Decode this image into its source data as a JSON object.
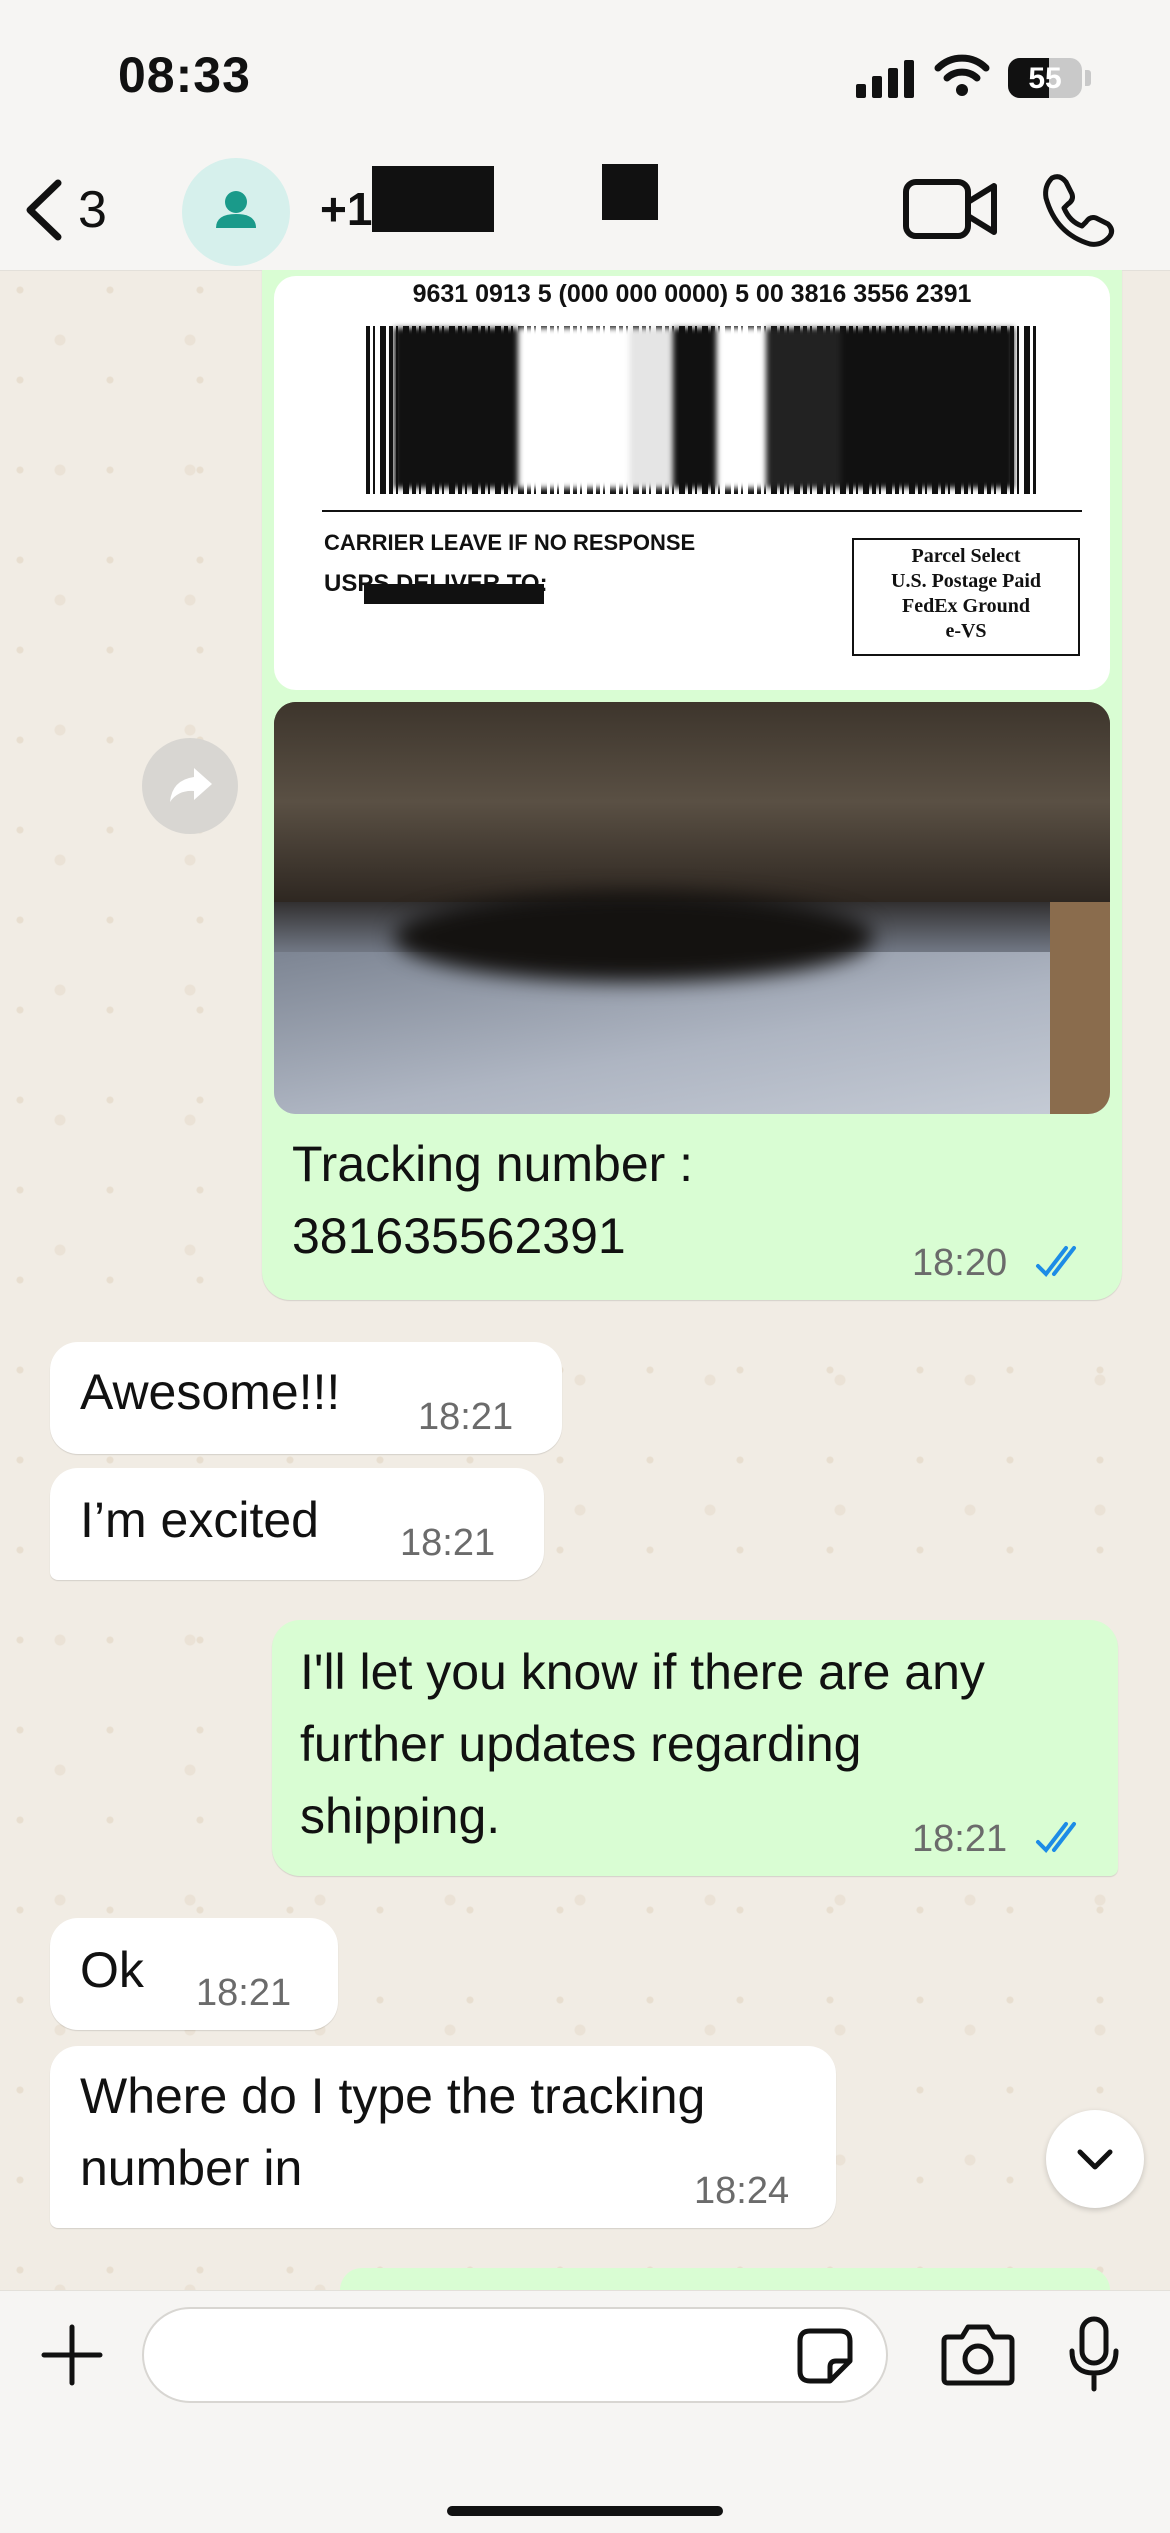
{
  "status_bar": {
    "time": "08:33",
    "battery": "55"
  },
  "header": {
    "back_count": "3",
    "contact_name": "+1"
  },
  "label_image": {
    "tracking_line": "9631 0913 5 (000 000 0000) 5 00 3816 3556 2391",
    "carrier_text": "CARRIER LEAVE IF NO RESPONSE",
    "deliver_text": "USPS DELIVER TO:",
    "postage_lines": [
      "Parcel Select",
      "U.S. Postage Paid",
      "FedEx Ground",
      "e-VS"
    ]
  },
  "messages": [
    {
      "direction": "outgoing",
      "text": "Tracking number :\n381635562391",
      "time": "18:20",
      "read": true
    },
    {
      "direction": "incoming",
      "text": "Awesome!!!",
      "time": "18:21"
    },
    {
      "direction": "incoming",
      "text": "I’m excited",
      "time": "18:21"
    },
    {
      "direction": "outgoing",
      "text": "I'll let you know if there are any\nfurther updates regarding\nshipping.",
      "time": "18:21",
      "read": true
    },
    {
      "direction": "incoming",
      "text": "Ok",
      "time": "18:21"
    },
    {
      "direction": "incoming",
      "text": "Where do I type the tracking\nnumber in",
      "time": "18:24"
    }
  ],
  "colors": {
    "outgoing_bubble": "#d9fdd3",
    "incoming_bubble": "#ffffff",
    "read_ticks": "#1d8ce6",
    "avatar_bg": "#d6f0ec",
    "avatar_icon": "#1a9a8a"
  },
  "icons": [
    "back-chevron-icon",
    "person-icon",
    "video-camera-icon",
    "phone-icon",
    "forward-icon",
    "chevron-down-icon",
    "plus-icon",
    "sticker-icon",
    "camera-icon",
    "microphone-icon"
  ]
}
